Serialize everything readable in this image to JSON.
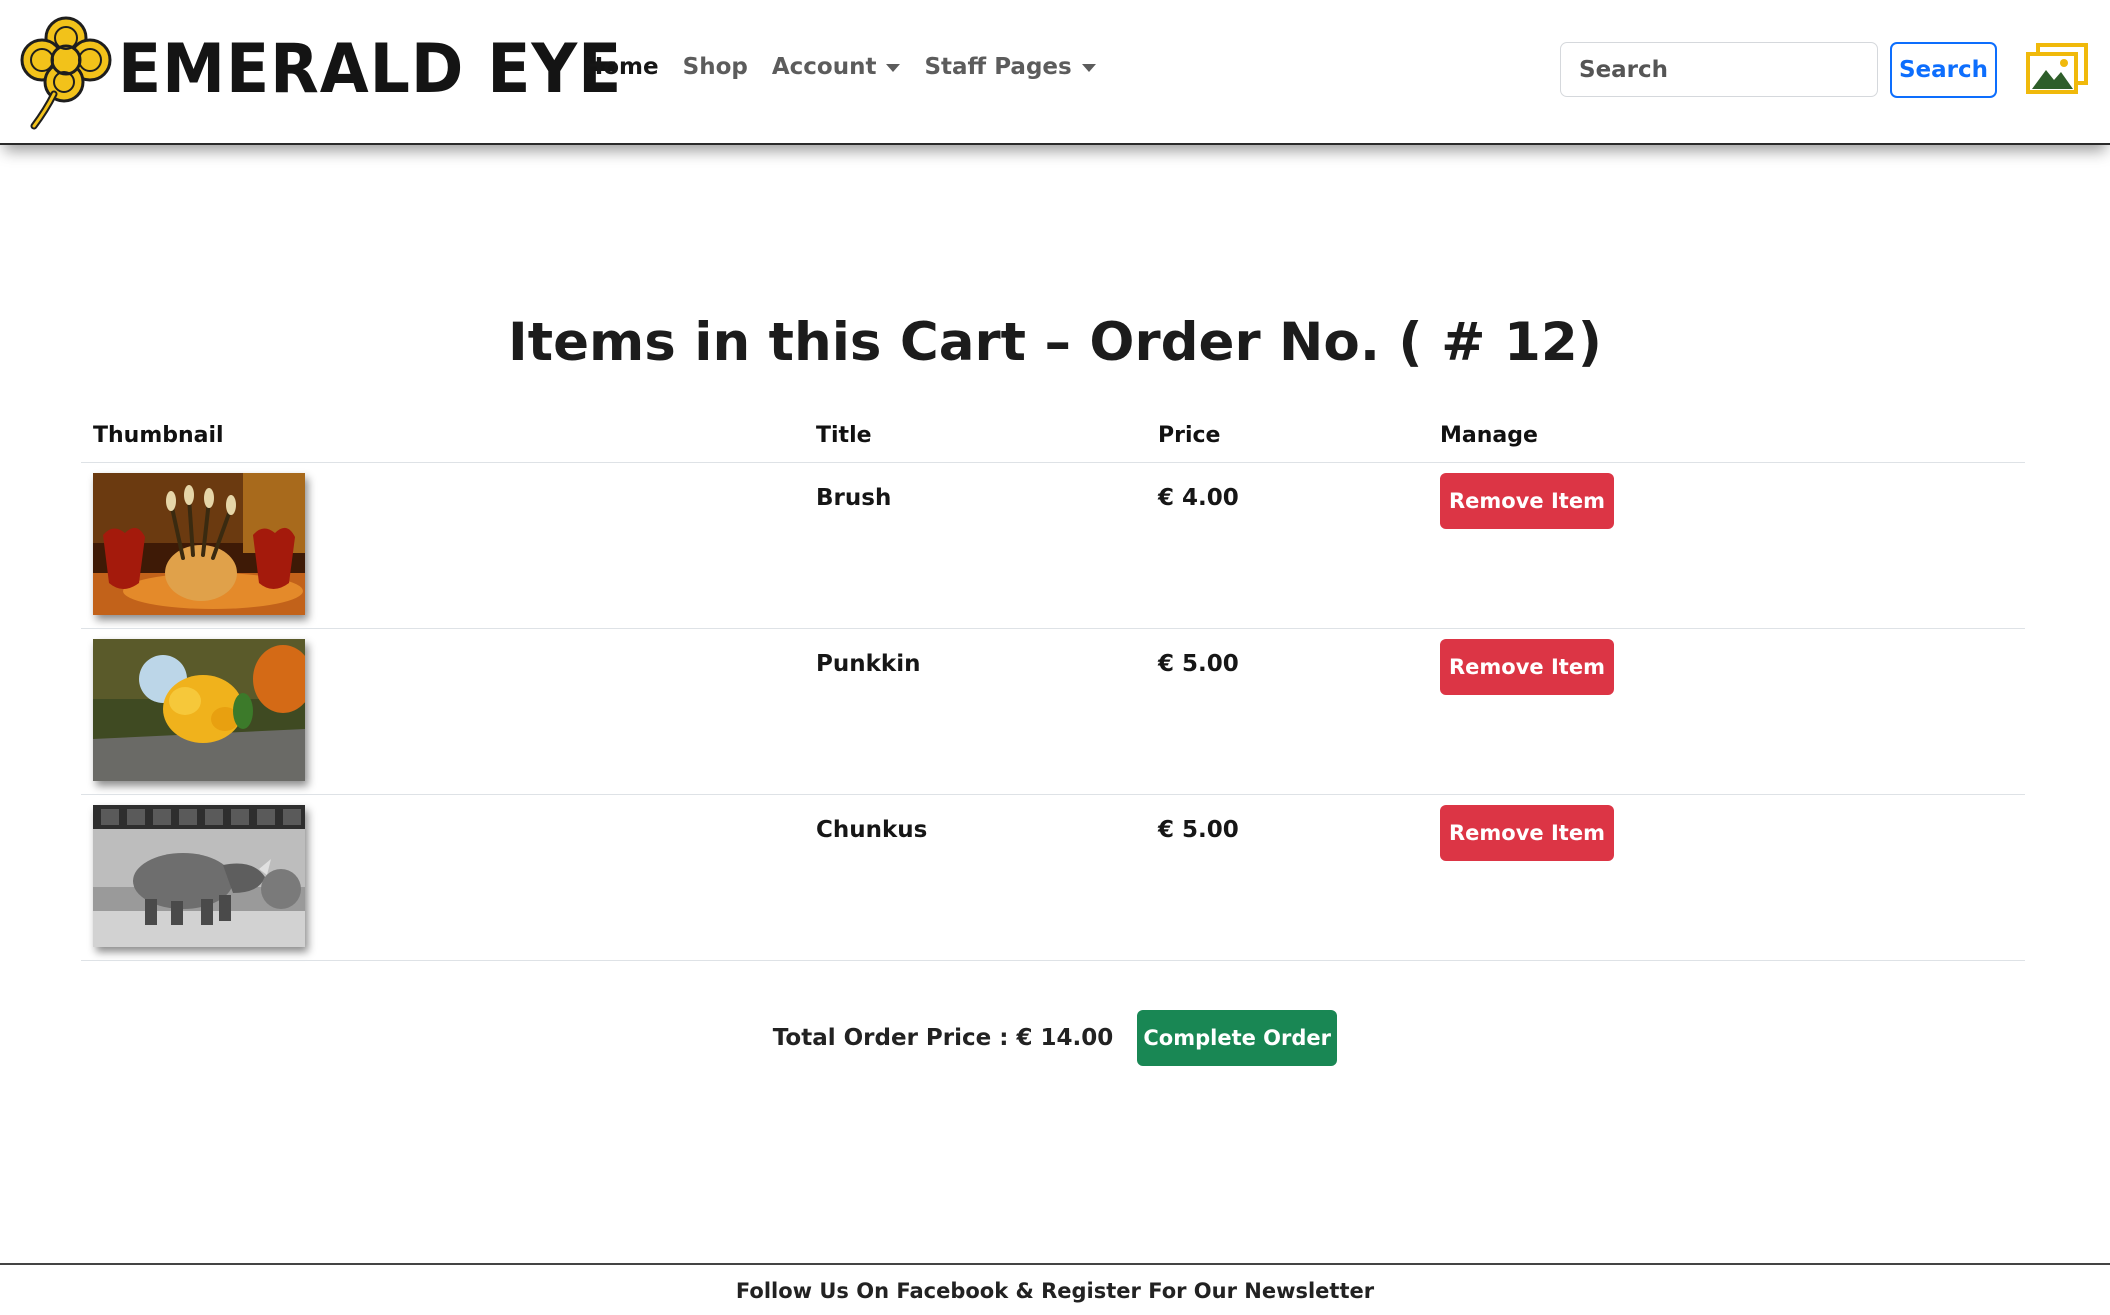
{
  "colors": {
    "logo_yellow": "#f0c419",
    "link_blue": "#0d6efd",
    "danger_red": "#dc3545",
    "success_green": "#198754"
  },
  "header": {
    "logo_icon": "clover-flower-icon",
    "brand": "EMERALD EYE",
    "nav": [
      {
        "label": "Home",
        "active": true
      },
      {
        "label": "Shop"
      },
      {
        "label": "Account",
        "dropdown": true
      },
      {
        "label": "Staff Pages",
        "dropdown": true
      }
    ],
    "search": {
      "placeholder": "Search",
      "button_label": "Search"
    },
    "gallery_icon": "image-gallery-icon"
  },
  "main": {
    "title": "Items in this Cart – Order No. ( # 12)",
    "columns": [
      "Thumbnail",
      "Title",
      "Price",
      "Manage"
    ],
    "items": [
      {
        "thumbnail": "brushes-in-pot-photo",
        "title": "Brush",
        "price": "€ 4.00",
        "action": "Remove Item"
      },
      {
        "thumbnail": "yellow-gourd-photo",
        "title": "Punkkin",
        "price": "€ 5.00",
        "action": "Remove Item"
      },
      {
        "thumbnail": "rhinoceros-bw-photo",
        "title": "Chunkus",
        "price": "€ 5.00",
        "action": "Remove Item"
      }
    ],
    "total_label": "Total Order Price : € 14.00",
    "complete_label": "Complete Order"
  },
  "footer": {
    "text": "Follow Us On Facebook & Register For Our Newsletter"
  }
}
